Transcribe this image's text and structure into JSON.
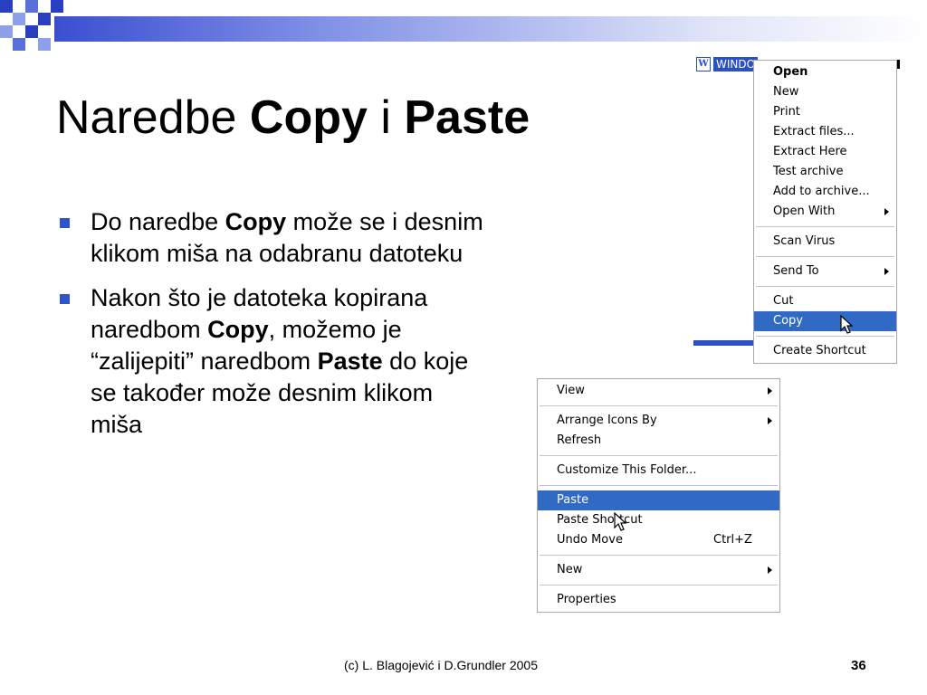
{
  "slide": {
    "title_plain": "Naredbe ",
    "title_bold1": "Copy",
    "title_mid": " i ",
    "title_bold2": "Paste",
    "bullets": [
      {
        "t1": "Do naredbe ",
        "b1": "Copy",
        "t2": " može se i desnim klikom miša na odabranu datoteku"
      },
      {
        "t1": "Nakon što je datoteka kopirana naredbom ",
        "b1": "Copy",
        "t2": ", možemo je “zalijepiti” naredbom ",
        "b2": "Paste",
        "t3": " do koje se također može desnim klikom miša"
      }
    ],
    "footer": "(c) L. Blagojević i D.Grundler 2005",
    "page_number": "36"
  },
  "file_menu": {
    "selected_file": "WINDO",
    "items": [
      "Open",
      "New",
      "Print",
      "Extract files...",
      "Extract Here",
      "Test archive",
      "Add to archive...",
      "Open With",
      "Scan Virus",
      "Send To",
      "Cut",
      "Copy",
      "Create Shortcut"
    ]
  },
  "folder_menu": {
    "items": [
      "View",
      "Arrange Icons By",
      "Refresh",
      "Customize This Folder...",
      "Paste",
      "Paste Shortcut",
      "Undo Move",
      "New",
      "Properties"
    ],
    "undo_shortcut": "Ctrl+Z"
  },
  "colors": {
    "accent": "#316ac5",
    "bullet": "#2f54c8"
  }
}
